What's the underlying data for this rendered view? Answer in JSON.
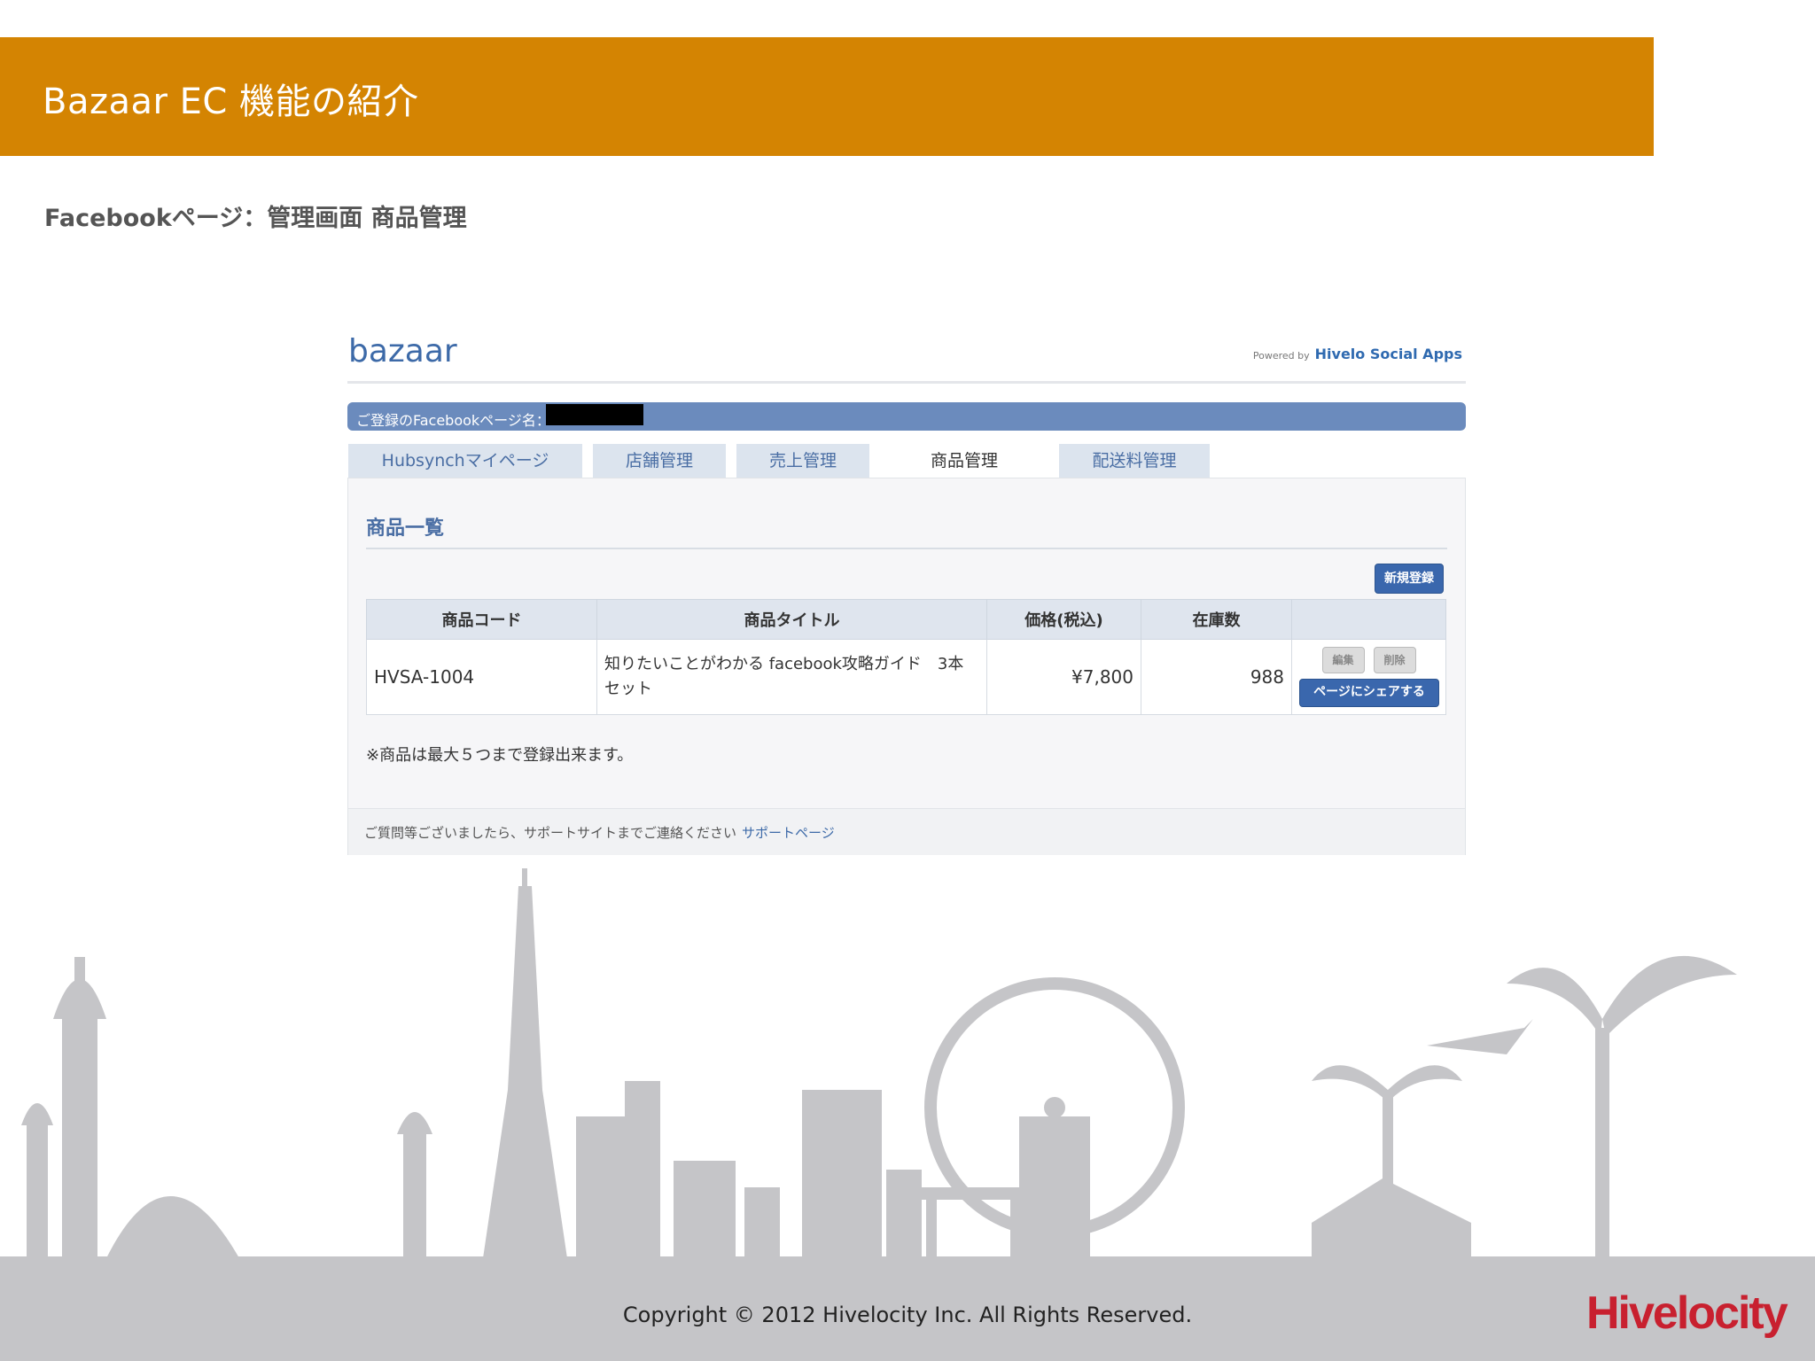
{
  "slide": {
    "title": "Bazaar EC 機能の紹介",
    "subtitle": "Facebookページ：管理画面 商品管理"
  },
  "app": {
    "brand": "bazaar",
    "powered_by": "Powered by",
    "powered_brand": "Hivelo Social Apps",
    "fb_page_label": "ご登録のFacebookページ名：",
    "tabs": [
      {
        "label": "Hubsynchマイページ",
        "active": false
      },
      {
        "label": "店舗管理",
        "active": false
      },
      {
        "label": "売上管理",
        "active": false
      },
      {
        "label": "商品管理",
        "active": true
      },
      {
        "label": "配送料管理",
        "active": false
      }
    ],
    "section_title": "商品一覧",
    "new_button": "新規登録",
    "table": {
      "headers": [
        "商品コード",
        "商品タイトル",
        "価格(税込)",
        "在庫数",
        ""
      ],
      "rows": [
        {
          "code": "HVSA-1004",
          "title": "知りたいことがわかる facebook攻略ガイド　3本セット",
          "price": "¥7,800",
          "stock": "988",
          "edit": "編集",
          "delete": "削除",
          "share": "ページにシェアする"
        }
      ]
    },
    "note": "※商品は最大５つまで登録出来ます。",
    "footer_text": "ご質問等ございましたら、サポートサイトまでご連絡ください",
    "footer_link": "サポートページ"
  },
  "footer": {
    "copyright": "Copyright © 2012 Hivelocity Inc. All Rights Reserved.",
    "brand": "Hivelocity"
  },
  "colors": {
    "header_orange": "#d48402",
    "app_blue": "#3a67ad",
    "brand_red": "#c8202f",
    "skyline_gray": "#c5c5c8"
  }
}
